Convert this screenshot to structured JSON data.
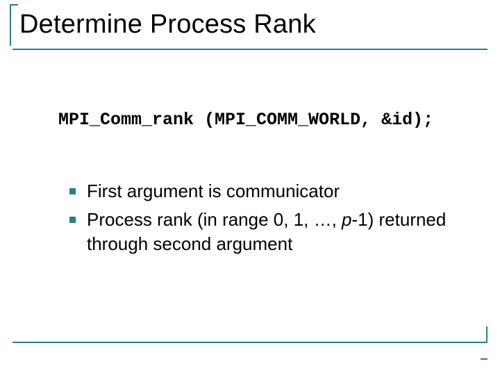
{
  "title": "Determine Process Rank",
  "code_line": "MPI_Comm_rank (MPI_COMM_WORLD, &id);",
  "bullets": [
    {
      "text": "First argument is communicator"
    },
    {
      "prefix": "Process rank (in range 0, 1, …, ",
      "ital": "p",
      "suffix": "-1) returned through second argument"
    }
  ],
  "accent_color": "#2a7f7f"
}
